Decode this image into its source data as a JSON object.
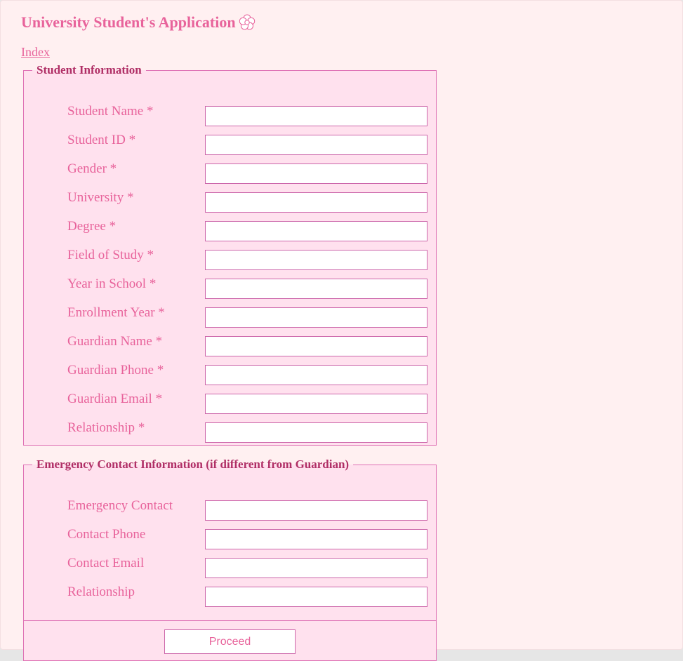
{
  "header": {
    "title": "University Student's Application",
    "icon": "flower-icon",
    "index_link": "Index"
  },
  "colors": {
    "accent": "#e8639b",
    "legend": "#b02f66",
    "border": "#de70b4",
    "panel_bg": "#ffe1ee",
    "page_bg": "#fff0f1"
  },
  "student_info": {
    "legend": "Student Information",
    "fields": [
      {
        "label": "Student Name",
        "required": "*",
        "value": ""
      },
      {
        "label": "Student ID",
        "required": "*",
        "value": ""
      },
      {
        "label": "Gender",
        "required": "*",
        "value": ""
      },
      {
        "label": "University",
        "required": "*",
        "value": ""
      },
      {
        "label": "Degree",
        "required": "*",
        "value": ""
      },
      {
        "label": "Field of Study",
        "required": "*",
        "value": ""
      },
      {
        "label": "Year in School",
        "required": "*",
        "value": ""
      },
      {
        "label": "Enrollment Year",
        "required": "*",
        "value": ""
      },
      {
        "label": "Guardian Name",
        "required": "*",
        "value": ""
      },
      {
        "label": "Guardian Phone",
        "required": "*",
        "value": ""
      },
      {
        "label": "Guardian Email",
        "required": "*",
        "value": ""
      },
      {
        "label": "Relationship",
        "required": "*",
        "value": ""
      }
    ]
  },
  "emergency_info": {
    "legend": "Emergency Contact Information (if different from Guardian)",
    "fields": [
      {
        "label": "Emergency Contact",
        "value": ""
      },
      {
        "label": "Contact Phone",
        "value": ""
      },
      {
        "label": "Contact Email",
        "value": ""
      },
      {
        "label": "Relationship",
        "value": ""
      }
    ],
    "proceed_label": "Proceed"
  }
}
